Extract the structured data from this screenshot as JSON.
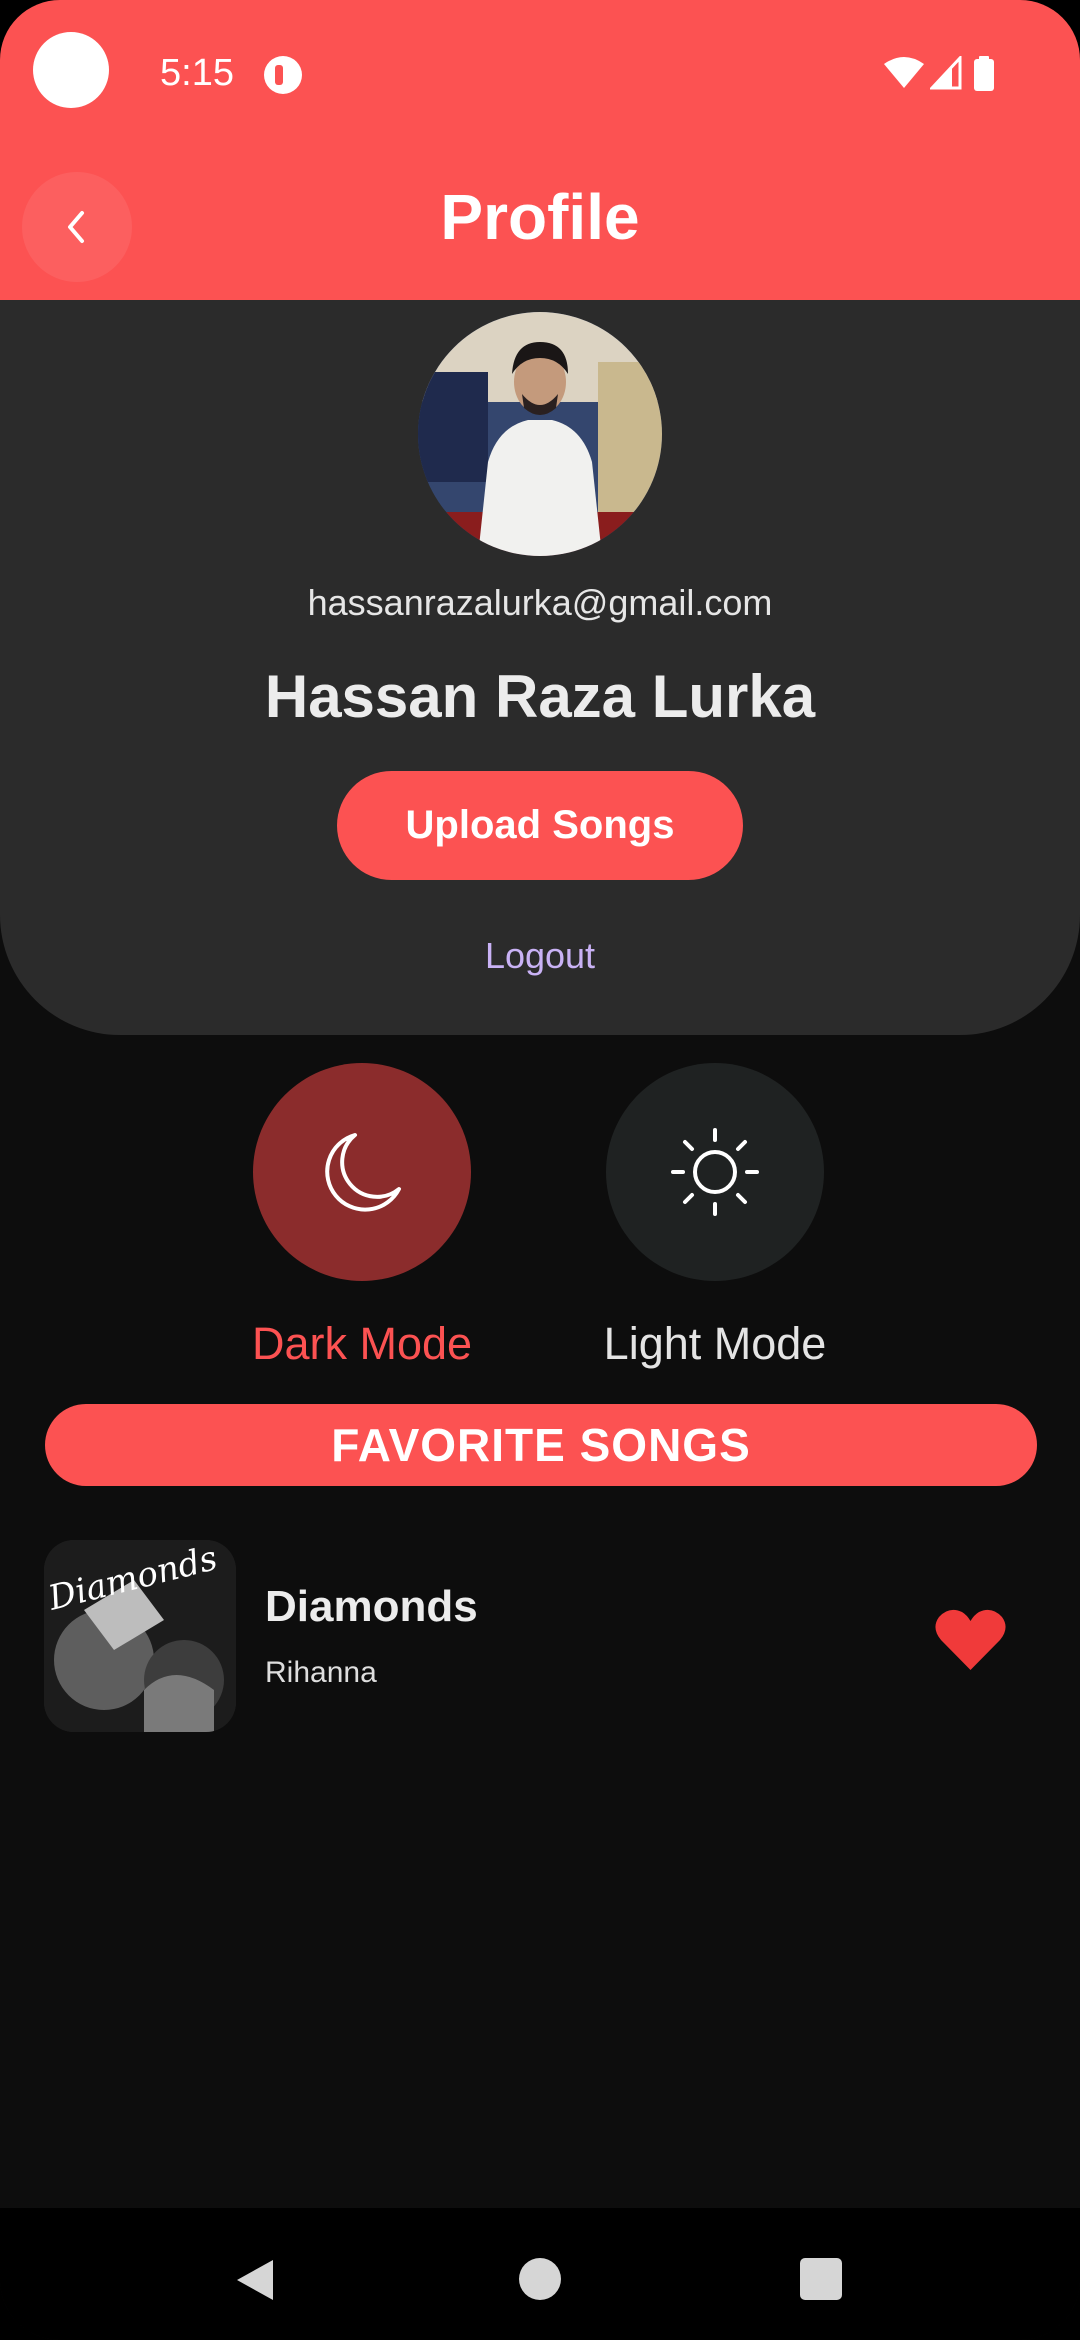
{
  "status_bar": {
    "time": "5:15"
  },
  "header": {
    "title": "Profile",
    "back_icon": "chevron-left-icon",
    "background_color": "#fc5252"
  },
  "profile": {
    "email": "hassanrazalurka@gmail.com",
    "name": "Hassan Raza Lurka",
    "upload_label": "Upload Songs",
    "logout_label": "Logout"
  },
  "theme_modes": {
    "dark_label": "Dark Mode",
    "light_label": "Light Mode",
    "dark_icon": "moon-icon",
    "light_icon": "sun-icon",
    "selected": "Dark Mode"
  },
  "favorites": {
    "heading": "FAVORITE SONGS",
    "songs": [
      {
        "title": "Diamonds",
        "artist": "Rihanna",
        "liked": true,
        "cover_script": "Diamonds"
      }
    ]
  },
  "colors": {
    "accent": "#fc5252",
    "card": "#2b2b2b",
    "background": "#0d0d0d",
    "logout": "#c9b2f5"
  }
}
